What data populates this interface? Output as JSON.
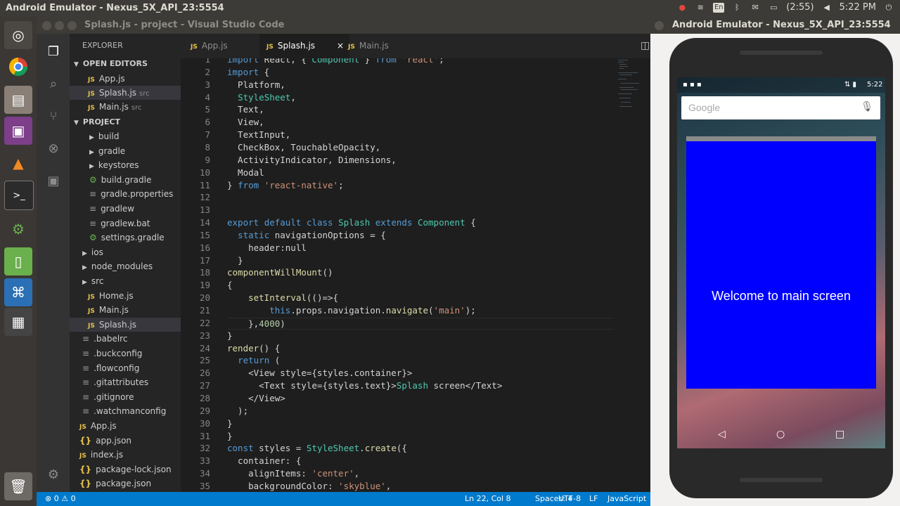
{
  "topbar": {
    "title": "Android Emulator - Nexus_5X_API_23:5554",
    "battery": "(2:55)",
    "time": "5:22 PM",
    "lang": "En"
  },
  "vscode": {
    "title": "Splash.js - project - Visual Studio Code",
    "tabs": [
      {
        "label": "App.js"
      },
      {
        "label": "Splash.js",
        "close": "×"
      },
      {
        "label": "Main.js"
      }
    ],
    "explorer": {
      "header": "EXPLORER",
      "open_editors": "OPEN EDITORS",
      "open": [
        {
          "name": "App.js",
          "sub": ""
        },
        {
          "name": "Splash.js",
          "sub": "src"
        },
        {
          "name": "Main.js",
          "sub": "src"
        }
      ],
      "project": "PROJECT",
      "tree": [
        {
          "name": "build",
          "kind": "folder"
        },
        {
          "name": "gradle",
          "kind": "folder"
        },
        {
          "name": "keystores",
          "kind": "folder"
        },
        {
          "name": "build.gradle",
          "kind": "gradle"
        },
        {
          "name": "gradle.properties",
          "kind": "plain"
        },
        {
          "name": "gradlew",
          "kind": "plain"
        },
        {
          "name": "gradlew.bat",
          "kind": "plain"
        },
        {
          "name": "settings.gradle",
          "kind": "gradle"
        },
        {
          "name": "ios",
          "kind": "folder"
        },
        {
          "name": "node_modules",
          "kind": "folder"
        },
        {
          "name": "src",
          "kind": "folder"
        },
        {
          "name": "Home.js",
          "kind": "js"
        },
        {
          "name": "Main.js",
          "kind": "js"
        },
        {
          "name": "Splash.js",
          "kind": "js"
        },
        {
          "name": ".babelrc",
          "kind": "plain"
        },
        {
          "name": ".buckconfig",
          "kind": "plain"
        },
        {
          "name": ".flowconfig",
          "kind": "plain"
        },
        {
          "name": ".gitattributes",
          "kind": "plain"
        },
        {
          "name": ".gitignore",
          "kind": "plain"
        },
        {
          "name": ".watchmanconfig",
          "kind": "plain"
        },
        {
          "name": "App.js",
          "kind": "js"
        },
        {
          "name": "app.json",
          "kind": "json"
        },
        {
          "name": "index.js",
          "kind": "js"
        },
        {
          "name": "package-lock.json",
          "kind": "json"
        },
        {
          "name": "package.json",
          "kind": "json"
        }
      ]
    },
    "code_lines": [
      {
        "n": "1",
        "t": "import React, { Component } from 'react';"
      },
      {
        "n": "2",
        "t": "import {"
      },
      {
        "n": "3",
        "t": "  Platform,"
      },
      {
        "n": "4",
        "t": "  StyleSheet,"
      },
      {
        "n": "5",
        "t": "  Text,"
      },
      {
        "n": "6",
        "t": "  View,"
      },
      {
        "n": "7",
        "t": "  TextInput,"
      },
      {
        "n": "8",
        "t": "  CheckBox, TouchableOpacity,"
      },
      {
        "n": "9",
        "t": "  ActivityIndicator, Dimensions,"
      },
      {
        "n": "10",
        "t": "  Modal"
      },
      {
        "n": "11",
        "t": "} from 'react-native';"
      },
      {
        "n": "12",
        "t": ""
      },
      {
        "n": "13",
        "t": ""
      },
      {
        "n": "14",
        "t": "export default class Splash extends Component {"
      },
      {
        "n": "15",
        "t": "  static navigationOptions = {"
      },
      {
        "n": "16",
        "t": "    header:null"
      },
      {
        "n": "17",
        "t": "  }"
      },
      {
        "n": "18",
        "t": "componentWillMount()"
      },
      {
        "n": "19",
        "t": "{"
      },
      {
        "n": "20",
        "t": "    setInterval(()=>{"
      },
      {
        "n": "21",
        "t": "        this.props.navigation.navigate('main');"
      },
      {
        "n": "22",
        "t": "    },4000)"
      },
      {
        "n": "23",
        "t": "}"
      },
      {
        "n": "24",
        "t": "render() {"
      },
      {
        "n": "25",
        "t": "  return ("
      },
      {
        "n": "26",
        "t": "    <View style={styles.container}>"
      },
      {
        "n": "27",
        "t": "      <Text style={styles.text}>Splash screen</Text>"
      },
      {
        "n": "28",
        "t": "    </View>"
      },
      {
        "n": "29",
        "t": "  );"
      },
      {
        "n": "30",
        "t": "}"
      },
      {
        "n": "31",
        "t": "}"
      },
      {
        "n": "32",
        "t": "const styles = StyleSheet.create({"
      },
      {
        "n": "33",
        "t": "  container: {"
      },
      {
        "n": "34",
        "t": "    alignItems: 'center',"
      },
      {
        "n": "35",
        "t": "    backgroundColor: 'skyblue',"
      }
    ],
    "status": {
      "errors": "0",
      "warnings": "0",
      "position": "Ln 22, Col 8",
      "spaces": "Spaces: 4",
      "encoding": "UTF-8",
      "eol": "LF",
      "language": "JavaScript"
    }
  },
  "emulator": {
    "title": "Android Emulator - Nexus_5X_API_23:5554",
    "phone_time": "5:22",
    "search_placeholder": "Google",
    "welcome": "Welcome to main screen"
  }
}
